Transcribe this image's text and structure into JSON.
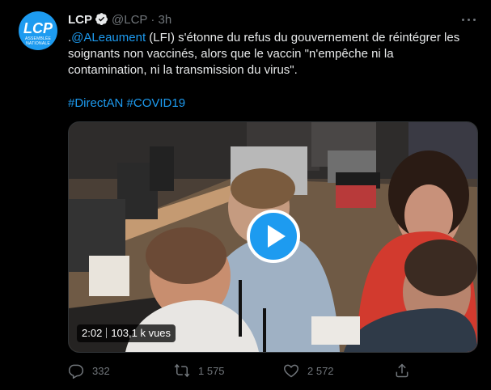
{
  "tweet": {
    "author_name": "LCP",
    "handle": "@LCP",
    "separator": "·",
    "time": "3h",
    "avatar_logo": "LCP",
    "avatar_sub": "ASSEMBLÉE NATIONALE",
    "text_prefix": ".",
    "mention": "@ALeaument",
    "text_body": " (LFI) s'étonne du refus du gouvernement de réintégrer les soignants non vaccinés, alors que le vaccin \"n'empêche ni la contamination, ni la transmission du virus\".",
    "hashtags": [
      "#DirectAN",
      "#COVID19"
    ]
  },
  "video": {
    "duration": "2:02",
    "views": "103,1 k vues"
  },
  "actions": {
    "replies": "332",
    "retweets": "1 575",
    "likes": "2 572"
  },
  "colors": {
    "accent": "#1d9bf0",
    "background": "#000000",
    "secondary_text": "#71767b"
  },
  "icons": [
    "verified-badge-icon",
    "more-icon",
    "play-icon",
    "reply-icon",
    "retweet-icon",
    "like-icon",
    "share-icon"
  ]
}
